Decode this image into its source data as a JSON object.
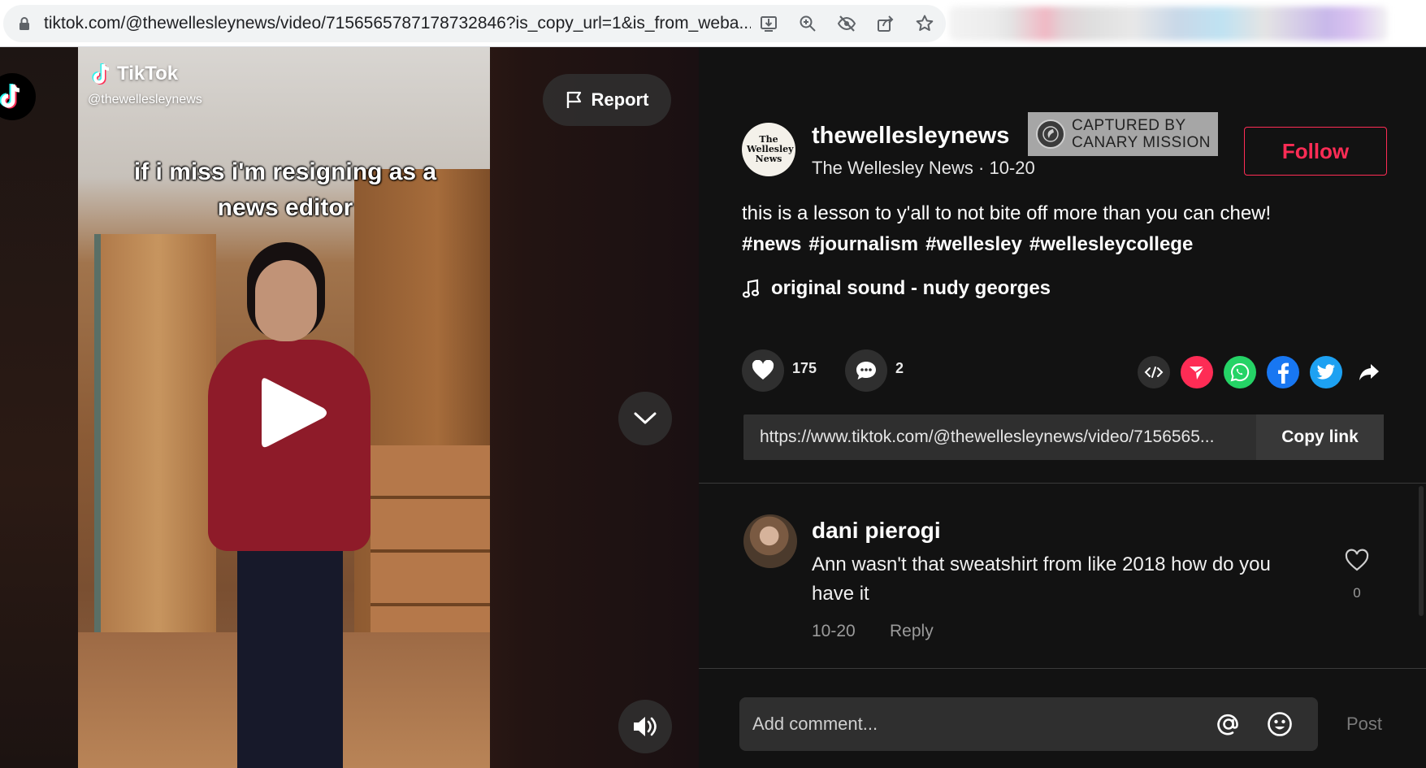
{
  "browser": {
    "url": "tiktok.com/@thewellesleynews/video/7156565787178732846?is_copy_url=1&is_from_weba..."
  },
  "video": {
    "logo_text": "TikTok",
    "handle": "@thewellesleynews",
    "caption": "if i miss i'm resigning as a news editor",
    "report_label": "Report"
  },
  "author": {
    "username": "thewellesleynews",
    "display_name": "The Wellesley News",
    "date": "10-20",
    "avatar_text": "The Wellesley News",
    "follow_label": "Follow"
  },
  "watermark": {
    "line1": "CAPTURED BY",
    "line2": "CANARY MISSION"
  },
  "post": {
    "description": "this is a lesson to y'all to not bite off more than you can chew!",
    "hashtags": [
      "#news",
      "#journalism",
      "#wellesley",
      "#wellesleycollege"
    ],
    "music": "original sound - nudy georges",
    "likes": "175",
    "comments": "2",
    "link": "https://www.tiktok.com/@thewellesleynews/video/7156565...",
    "copy_link_label": "Copy link"
  },
  "comment": {
    "author": "dani pierogi",
    "text": "Ann wasn't that sweatshirt from like 2018 how do you have it",
    "date": "10-20",
    "reply_label": "Reply",
    "likes": "0"
  },
  "composer": {
    "placeholder": "Add comment...",
    "post_label": "Post"
  },
  "colors": {
    "accent": "#fe2c55",
    "whatsapp": "#25d366",
    "facebook": "#1877f2",
    "twitter": "#1da1f2",
    "share_red": "#fe2c55"
  },
  "icons": [
    "lock-icon",
    "install-icon",
    "zoom-icon",
    "eye-off-icon",
    "share-page-icon",
    "bookmark-star-icon",
    "flag-icon",
    "play-icon",
    "chevron-down-icon",
    "volume-icon",
    "music-note-icon",
    "heart-icon",
    "comment-icon",
    "embed-icon",
    "send-icon",
    "whatsapp-icon",
    "facebook-icon",
    "twitter-icon",
    "share-arrow-icon",
    "mention-icon",
    "emoji-icon"
  ]
}
